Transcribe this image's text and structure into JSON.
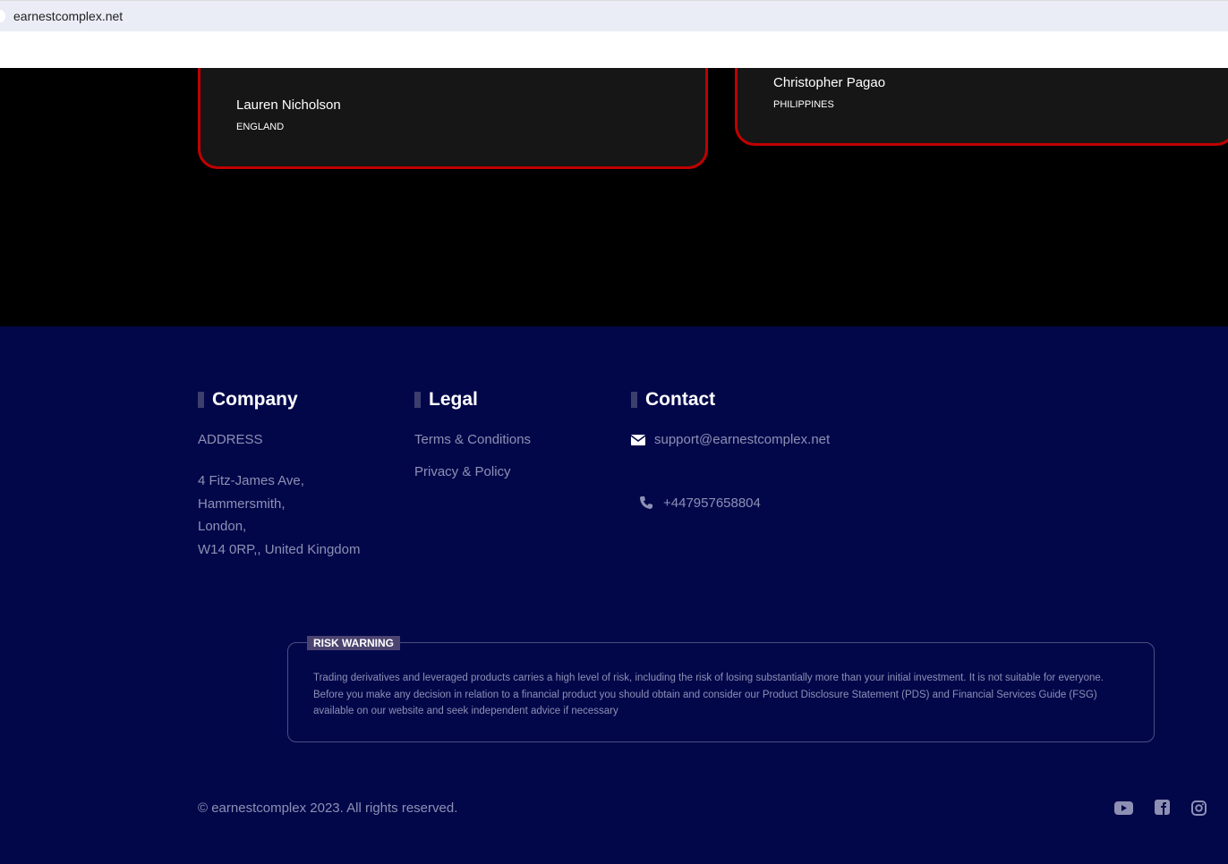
{
  "browser": {
    "url": "earnestcomplex.net"
  },
  "testimonials": [
    {
      "name": "Lauren Nicholson",
      "country": "ENGLAND"
    },
    {
      "name": "Christopher Pagao",
      "country": "PHILIPPINES"
    }
  ],
  "footer": {
    "company": {
      "title": "Company",
      "address_label": "ADDRESS",
      "address_lines": [
        "4 Fitz-James Ave,",
        "Hammersmith,",
        "London,",
        "W14 0RP,, United Kingdom"
      ]
    },
    "legal": {
      "title": "Legal",
      "links": [
        "Terms & Conditions",
        "Privacy & Policy"
      ]
    },
    "contact": {
      "title": "Contact",
      "email": "support@earnestcomplex.net",
      "phone": "+447957658804"
    },
    "risk": {
      "label": "RISK WARNING",
      "text": "Trading derivatives and leveraged products carries a high level of risk, including the risk of losing substantially more than your initial investment. It is not suitable for everyone. Before you make any decision in relation to a financial product you should obtain and consider our Product Disclosure Statement (PDS) and Financial Services Guide (FSG) available on our website and seek independent advice if necessary"
    },
    "copyright": "© earnestcomplex 2023. All rights reserved.",
    "social": [
      "youtube-icon",
      "facebook-icon",
      "instagram-icon"
    ]
  }
}
